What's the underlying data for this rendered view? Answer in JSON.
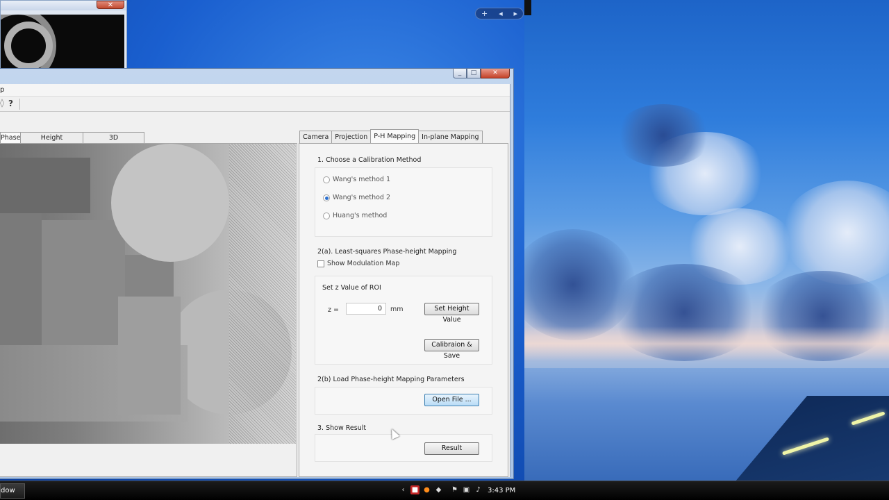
{
  "background_window": {
    "close_glyph": "✕"
  },
  "gadget_bar": {
    "add_glyph": "+",
    "prev_glyph": "◂",
    "next_glyph": "▸"
  },
  "main_window": {
    "menu_partial": "p",
    "help_glyph": "?",
    "left_tabs": [
      {
        "label": "Phase",
        "active": true
      },
      {
        "label": "Height",
        "active": false
      },
      {
        "label": "3D",
        "active": false
      }
    ],
    "right_tabs": [
      {
        "label": "Camera",
        "active": false
      },
      {
        "label": "Projection",
        "active": false
      },
      {
        "label": "P-H Mapping",
        "active": true
      },
      {
        "label": "In-plane Mapping",
        "active": false
      }
    ],
    "ph_mapping": {
      "step1_title": "1. Choose a Calibration Method",
      "methods": [
        {
          "label": "Wang's method 1",
          "selected": false
        },
        {
          "label": "Wang's method 2",
          "selected": true
        },
        {
          "label": "Huang's method",
          "selected": false
        }
      ],
      "step2a_title": "2(a). Least-squares Phase-height Mapping",
      "show_modulation_map": {
        "label": "Show Modulation Map",
        "checked": false
      },
      "roi_title": "Set z Value of ROI",
      "z_label": "z  =",
      "z_value": "0",
      "z_unit": "mm",
      "set_height_button": "Set Height Value",
      "calibration_save_button": "Calibraion & Save",
      "step2b_title": "2(b)  Load Phase-height Mapping Parameters",
      "open_file_button": "Open File ...",
      "step3_title": "3. Show Result",
      "result_button": "Result"
    }
  },
  "taskbar": {
    "task_label": "dow",
    "clock": "3:43 PM",
    "tray_chevron": "‹"
  },
  "colors": {
    "desktop_blue": "#1a5fcf",
    "window_frame": "#a9c3e6",
    "close_red": "#c4432a",
    "radio_selected": "#2a6fcf"
  }
}
